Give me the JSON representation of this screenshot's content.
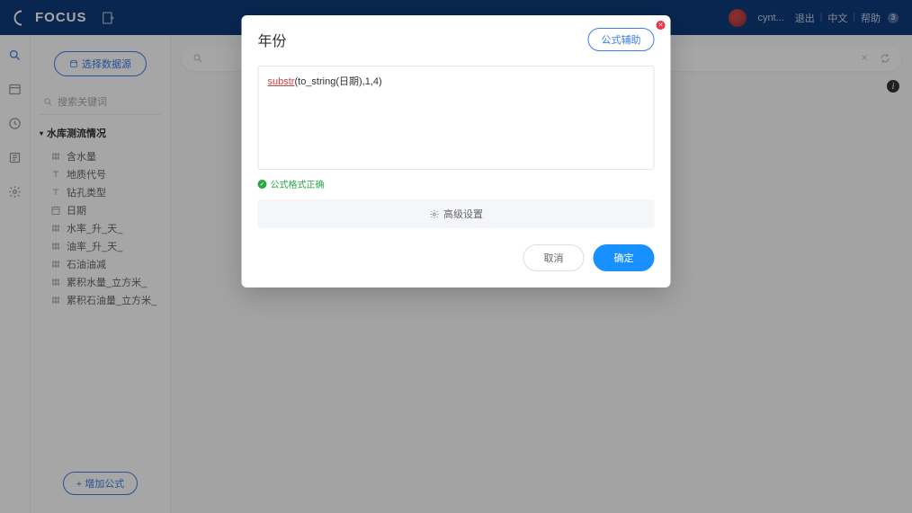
{
  "header": {
    "logo": "FOCUS",
    "user": "cynt...",
    "links": {
      "logout": "退出",
      "lang": "中文",
      "help": "帮助",
      "help_count": "3"
    }
  },
  "sidebar": {
    "select_source": "选择数据源",
    "search_placeholder": "搜索关键词",
    "tree_title": "水库测流情况",
    "fields": [
      {
        "icon": "num",
        "label": "含水量"
      },
      {
        "icon": "txt",
        "label": "地质代号"
      },
      {
        "icon": "txt",
        "label": "钻孔类型"
      },
      {
        "icon": "date",
        "label": "日期"
      },
      {
        "icon": "num",
        "label": "水率_升_天_"
      },
      {
        "icon": "num",
        "label": "油率_升_天_"
      },
      {
        "icon": "num",
        "label": "石油油减"
      },
      {
        "icon": "num",
        "label": "累积水量_立方米_"
      },
      {
        "icon": "num",
        "label": "累积石油量_立方米_"
      }
    ],
    "add_formula": "+ 增加公式"
  },
  "main": {
    "info_icon": "i"
  },
  "modal": {
    "title": "年份",
    "formula_help": "公式辅助",
    "formula": {
      "fn": "substr",
      "rest": "(to_string(日期),1,4)"
    },
    "validation": "公式格式正确",
    "advanced": "高级设置",
    "cancel": "取消",
    "confirm": "确定"
  }
}
